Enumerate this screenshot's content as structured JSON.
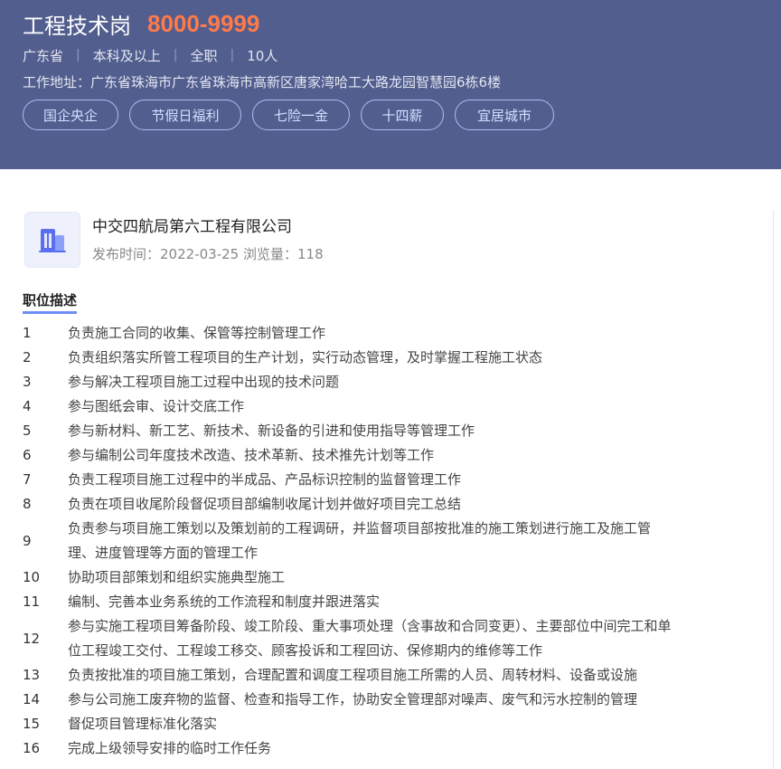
{
  "header": {
    "job_title": "工程技术岗",
    "salary": "8000-9999",
    "meta": {
      "location": "广东省",
      "education": "本科及以上",
      "job_type": "全职",
      "headcount": "10人",
      "separator": "|"
    },
    "address": "工作地址：广东省珠海市广东省珠海市高新区唐家湾哈工大路龙园智慧园6栋6楼",
    "tags": [
      "国企央企",
      "节假日福利",
      "七险一金",
      "十四薪",
      "宜居城市"
    ]
  },
  "company": {
    "logo_icon": "building-icon",
    "name": "中交四航局第六工程有限公司",
    "publish_label": "发布时间：",
    "publish_date": "2022-03-25",
    "views_label": "浏览量：",
    "views": "118"
  },
  "description": {
    "title": "职位描述",
    "items": [
      {
        "num": "1",
        "text": "负责施工合同的收集、保管等控制管理工作"
      },
      {
        "num": "2",
        "text": "负责组织落实所管工程项目的生产计划，实行动态管理，及时掌握工程施工状态"
      },
      {
        "num": "3",
        "text": "参与解决工程项目施工过程中出现的技术问题"
      },
      {
        "num": "4",
        "text": "参与图纸会审、设计交底工作"
      },
      {
        "num": "5",
        "text": "参与新材料、新工艺、新技术、新设备的引进和使用指导等管理工作"
      },
      {
        "num": "6",
        "text": "参与编制公司年度技术改造、技术革新、技术推先计划等工作"
      },
      {
        "num": "7",
        "text": "负责工程项目施工过程中的半成品、产品标识控制的监督管理工作"
      },
      {
        "num": "8",
        "text": "负责在项目收尾阶段督促项目部编制收尾计划并做好项目完工总结"
      },
      {
        "num": "9",
        "text": "负责参与项目施工策划以及策划前的工程调研，并监督项目部按批准的施工策划进行施工及施工管理、进度管理等方面的管理工作"
      },
      {
        "num": "10",
        "text": "协助项目部策划和组织实施典型施工"
      },
      {
        "num": "11",
        "text": "编制、完善本业务系统的工作流程和制度并跟进落实"
      },
      {
        "num": "12",
        "text": "参与实施工程项目筹备阶段、竣工阶段、重大事项处理（含事故和合同变更）、主要部位中间完工和单位工程竣工交付、工程竣工移交、顾客投诉和工程回访、保修期内的维修等工作"
      },
      {
        "num": "13",
        "text": "负责按批准的项目施工策划，合理配置和调度工程项目施工所需的人员、周转材料、设备或设施"
      },
      {
        "num": "14",
        "text": "参与公司施工废弃物的监督、检查和指导工作，协助安全管理部对噪声、废气和污水控制的管理"
      },
      {
        "num": "15",
        "text": "督促项目管理标准化落实"
      },
      {
        "num": "16",
        "text": "完成上级领导安排的临时工作任务"
      }
    ]
  }
}
